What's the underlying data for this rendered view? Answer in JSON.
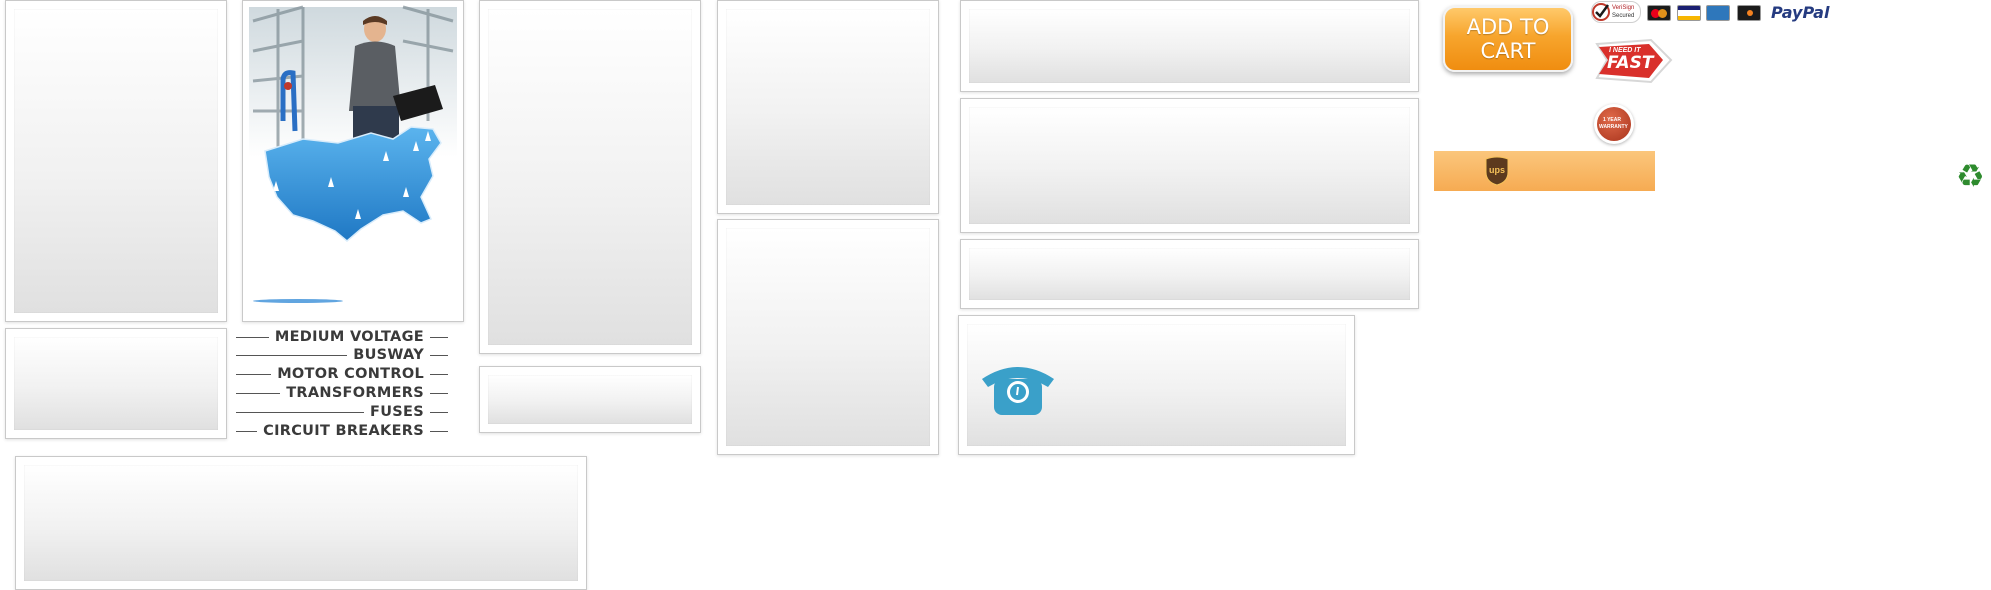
{
  "categories": [
    "MEDIUM VOLTAGE",
    "BUSWAY",
    "MOTOR CONTROL",
    "TRANSFORMERS",
    "FUSES",
    "CIRCUIT BREAKERS"
  ],
  "cart": {
    "label": "ADD TO CART"
  },
  "badges": {
    "secured_line1": "VeriSign",
    "secured_line2": "Secured",
    "need_it_line1": "I NEED IT",
    "need_it_line2": "FAST",
    "warranty_line1": "1 YEAR",
    "warranty_line2": "WARRANTY",
    "paypal": "PayPal",
    "ups": "ups"
  },
  "icons": {
    "phone": "telephone-icon",
    "recycle": "recycle-icon",
    "recycle_glyph": "♻"
  },
  "colors": {
    "cart_orange": "#f7a52d",
    "map_blue": "#2e8fd8",
    "phone_teal": "#3aa0c9",
    "recycle_green": "#2e8b2e",
    "ups_brown": "#5c3a1e"
  }
}
